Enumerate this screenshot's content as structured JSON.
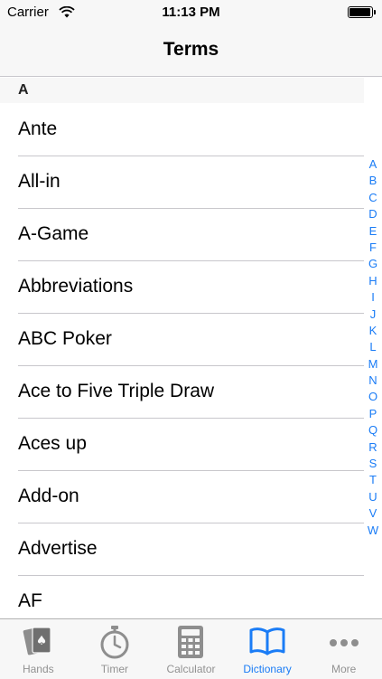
{
  "status_bar": {
    "carrier": "Carrier",
    "time": "11:13 PM"
  },
  "nav": {
    "title": "Terms"
  },
  "section": {
    "header": "A"
  },
  "terms": [
    "Ante",
    "All-in",
    "A-Game",
    "Abbreviations",
    "ABC Poker",
    "Ace to Five Triple Draw",
    "Aces up",
    "Add-on",
    "Advertise",
    "AF"
  ],
  "index_letters": [
    "A",
    "B",
    "C",
    "D",
    "E",
    "F",
    "G",
    "H",
    "I",
    "J",
    "K",
    "L",
    "M",
    "N",
    "O",
    "P",
    "Q",
    "R",
    "S",
    "T",
    "U",
    "V",
    "W"
  ],
  "tabs": [
    {
      "label": "Hands",
      "icon": "cards-icon",
      "active": false
    },
    {
      "label": "Timer",
      "icon": "stopwatch-icon",
      "active": false
    },
    {
      "label": "Calculator",
      "icon": "calculator-icon",
      "active": false
    },
    {
      "label": "Dictionary",
      "icon": "book-icon",
      "active": true
    },
    {
      "label": "More",
      "icon": "more-icon",
      "active": false
    }
  ],
  "colors": {
    "accent": "#1a7cf6",
    "inactive": "#929292",
    "bar_bg": "#f7f7f7",
    "separator": "#c8c7cc"
  }
}
